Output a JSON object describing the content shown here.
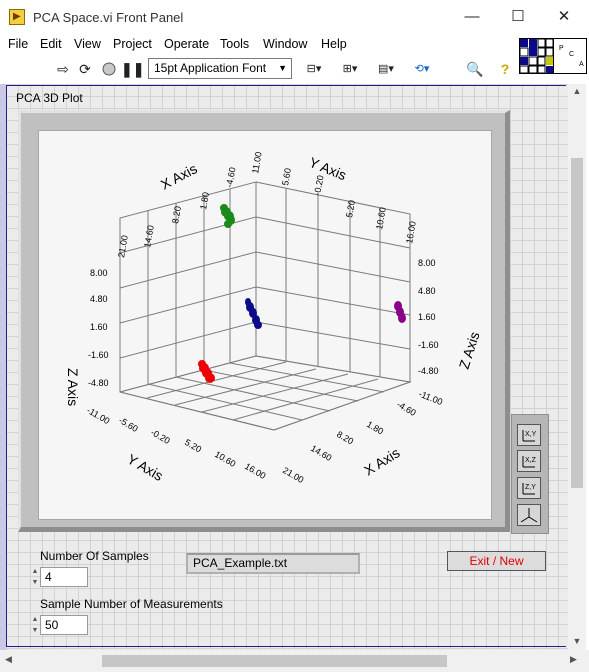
{
  "window": {
    "title": "PCA Space.vi Front Panel",
    "minimize": "—",
    "maximize": "☐",
    "close": "✕"
  },
  "menu": [
    "File",
    "Edit",
    "View",
    "Project",
    "Operate",
    "Tools",
    "Window",
    "Help"
  ],
  "toolbar": {
    "font": "15pt Application Font"
  },
  "connector": {
    "p": "P",
    "c": "C",
    "a": "A"
  },
  "plot": {
    "label": "PCA 3D Plot",
    "x_axis_title": "X Axis",
    "y_axis_title": "Y Axis",
    "z_axis_title": "Z Axis",
    "top_x_ticks": [
      "21.00",
      "14.60",
      "8.20",
      "1.80",
      "-4.60",
      "11.00"
    ],
    "top_y_ticks": [
      "5.60",
      "-0.20",
      "5.20",
      "10.60",
      "16.00"
    ],
    "left_z_ticks": [
      "8.00",
      "4.80",
      "1.60",
      "-1.60",
      "-4.80"
    ],
    "right_z_ticks": [
      "8.00",
      "4.80",
      "1.60",
      "-1.60",
      "-4.80",
      "-11.00"
    ],
    "bottom_y_ticks": [
      "-11.00",
      "-5.60",
      "-0.20",
      "5.20",
      "10.60",
      "16.00"
    ],
    "bottom_x_ticks": [
      "-4.60",
      "1.80",
      "8.20",
      "14.60",
      "21.00"
    ],
    "view_buttons": [
      "xy",
      "xz",
      "yz",
      "3d"
    ],
    "cluster_colors": [
      "#1a8a1a",
      "#0b0b8a",
      "#ee0000",
      "#8a008a"
    ]
  },
  "controls": {
    "num_samples_label": "Number Of Samples",
    "num_samples_value": "4",
    "sample_num_label": "Sample Number of Measurements",
    "sample_num_value": "50",
    "file_path": "PCA_Example.txt",
    "exit_button": "Exit / New"
  }
}
